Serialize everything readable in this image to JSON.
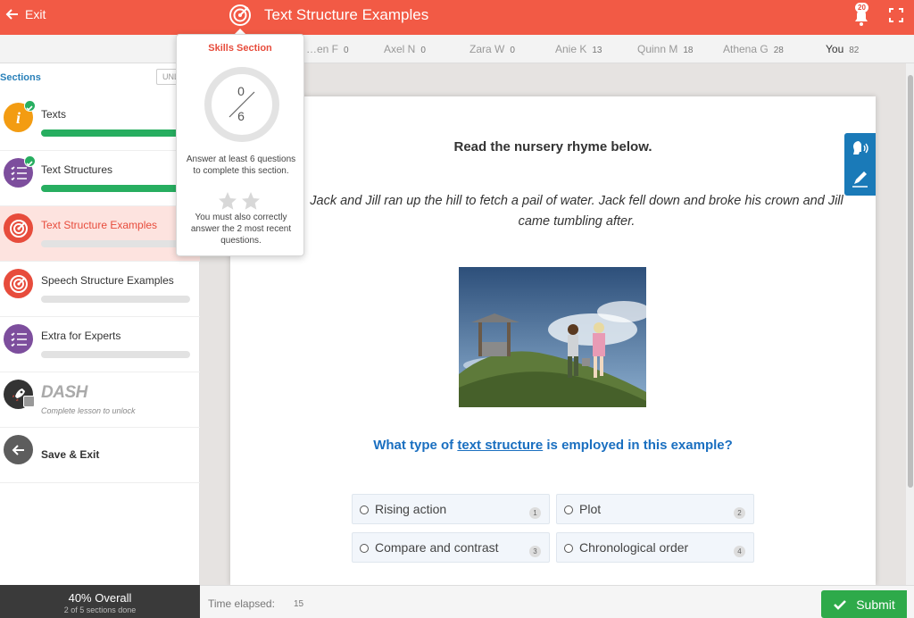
{
  "header": {
    "exit_label": "Exit",
    "title": "Text Structure Examples",
    "notification_count": "20"
  },
  "leaderboard": [
    {
      "name": "…en F",
      "score": "0"
    },
    {
      "name": "Axel N",
      "score": "0"
    },
    {
      "name": "Zara W",
      "score": "0"
    },
    {
      "name": "Anie K",
      "score": "13"
    },
    {
      "name": "Quinn M",
      "score": "18"
    },
    {
      "name": "Athena G",
      "score": "28"
    },
    {
      "name": "You",
      "score": "82"
    }
  ],
  "sidebar": {
    "header": "Sections",
    "unlock_label": "UNL",
    "sections": [
      {
        "label": "Texts",
        "icon": "info-icon",
        "color": "#f39c12",
        "progress": 1.0,
        "completed": true
      },
      {
        "label": "Text Structures",
        "icon": "list-icon",
        "color": "#7d4e9d",
        "progress": 1.0,
        "completed": true
      },
      {
        "label": "Text Structure Examples",
        "icon": "target-icon",
        "color": "#e74c3c",
        "progress": 0.0,
        "active": true
      },
      {
        "label": "Speech Structure Examples",
        "icon": "target-icon",
        "color": "#e74c3c",
        "progress": 0.0
      },
      {
        "label": "Extra for Experts",
        "icon": "list-icon",
        "color": "#7d4e9d",
        "progress": 0.0
      }
    ],
    "dash": {
      "logo": "DASH",
      "subtitle": "Complete lesson to unlock"
    },
    "save_exit_label": "Save & Exit"
  },
  "overall": {
    "main": "40% Overall",
    "sub": "2 of 5 sections done"
  },
  "popup": {
    "title": "Skills Section",
    "answered": "0",
    "required": "6",
    "text1": "Answer at least 6 questions to complete this section.",
    "text2": "You must also correctly answer the 2 most recent questions."
  },
  "question_card": {
    "instruction": "Read the nursery rhyme below.",
    "rhyme": "Jack and Jill ran up the hill to fetch a pail of water. Jack fell down and broke his crown and Jill came tumbling after.",
    "question_prefix": "What type of ",
    "question_link": "text structure",
    "question_suffix": " is employed in this example?",
    "options": [
      {
        "label": "Rising action",
        "num": "1"
      },
      {
        "label": "Plot",
        "num": "2"
      },
      {
        "label": "Compare and contrast",
        "num": "3"
      },
      {
        "label": "Chronological order",
        "num": "4"
      }
    ]
  },
  "footer": {
    "time_label": "Time elapsed:",
    "time_value": "15",
    "submit_label": "Submit"
  },
  "colors": {
    "brand": "#f25a45",
    "accent_blue": "#1a6fc0",
    "success": "#2eaa4a"
  }
}
